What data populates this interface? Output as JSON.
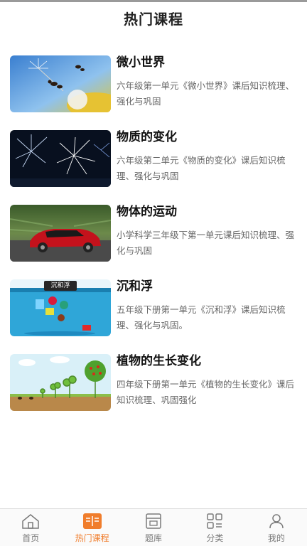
{
  "header": {
    "title": "热门课程"
  },
  "courses": [
    {
      "title": "微小世界",
      "desc": "六年级第一单元《微小世界》课后知识梳理、强化与巩固"
    },
    {
      "title": "物质的变化",
      "desc": "六年级第二单元《物质的变化》课后知识梳理、强化与巩固"
    },
    {
      "title": "物体的运动",
      "desc": "小学科学三年级下第一单元课后知识梳理、强化与巩固"
    },
    {
      "title": "沉和浮",
      "desc": "五年级下册第一单元《沉和浮》课后知识梳理、强化与巩固。",
      "thumb_caption": "沉和浮"
    },
    {
      "title": "植物的生长变化",
      "desc": "四年级下册第一单元《植物的生长变化》课后知识梳理、巩固强化"
    }
  ],
  "tabbar": {
    "items": [
      {
        "label": "首页",
        "icon": "home-icon"
      },
      {
        "label": "热门课程",
        "icon": "book-icon",
        "active": true
      },
      {
        "label": "题库",
        "icon": "question-bank-icon"
      },
      {
        "label": "分类",
        "icon": "category-grid-icon"
      },
      {
        "label": "我的",
        "icon": "user-icon"
      }
    ]
  },
  "colors": {
    "accent": "#f07d2c",
    "tab_inactive": "#7a7a7a"
  }
}
